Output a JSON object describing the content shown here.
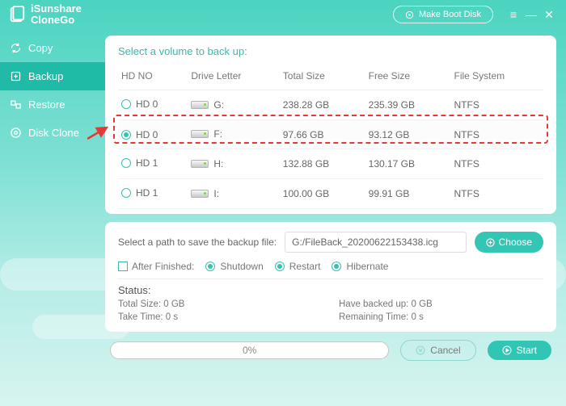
{
  "brand": {
    "line1": "iSunshare",
    "line2": "CloneGo"
  },
  "header": {
    "make_boot": "Make Boot Disk"
  },
  "sidebar": {
    "items": [
      {
        "label": "Copy"
      },
      {
        "label": "Backup"
      },
      {
        "label": "Restore"
      },
      {
        "label": "Disk Clone"
      }
    ]
  },
  "volume": {
    "title": "Select a volume to back up:",
    "columns": {
      "hdno": "HD NO",
      "letter": "Drive Letter",
      "total": "Total Size",
      "free": "Free Size",
      "fs": "File System"
    },
    "rows": [
      {
        "hd": "HD 0",
        "letter": "G:",
        "total": "238.28 GB",
        "free": "235.39 GB",
        "fs": "NTFS",
        "selected": false
      },
      {
        "hd": "HD 0",
        "letter": "F:",
        "total": "97.66 GB",
        "free": "93.12 GB",
        "fs": "NTFS",
        "selected": true
      },
      {
        "hd": "HD 1",
        "letter": "H:",
        "total": "132.88 GB",
        "free": "130.17 GB",
        "fs": "NTFS",
        "selected": false
      },
      {
        "hd": "HD 1",
        "letter": "I:",
        "total": "100.00 GB",
        "free": "99.91 GB",
        "fs": "NTFS",
        "selected": false
      }
    ]
  },
  "save": {
    "label": "Select a path to save the backup file:",
    "path": "G:/FileBack_20200622153438.icg",
    "choose": "Choose",
    "after_label": "After Finished:",
    "opts": {
      "shutdown": "Shutdown",
      "restart": "Restart",
      "hibernate": "Hibernate"
    }
  },
  "status": {
    "header": "Status:",
    "total": "Total Size: 0 GB",
    "backed": "Have backed up: 0 GB",
    "take": "Take Time: 0 s",
    "remain": "Remaining Time: 0 s"
  },
  "footer": {
    "progress": "0%",
    "cancel": "Cancel",
    "start": "Start"
  }
}
